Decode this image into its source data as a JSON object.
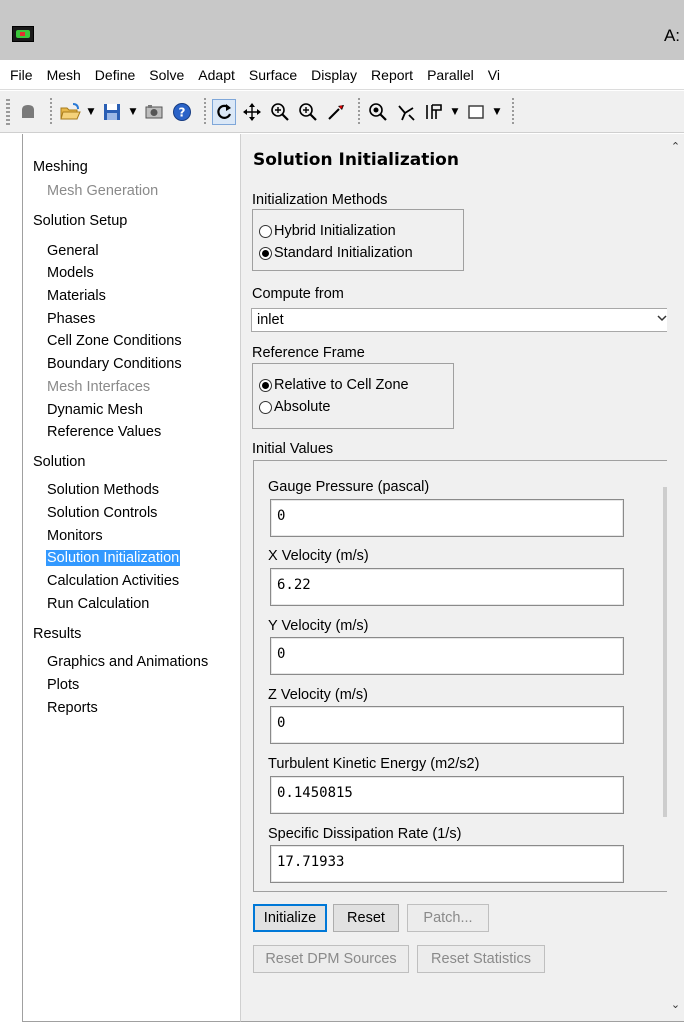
{
  "window": {
    "title_fragment": "A:"
  },
  "menu": [
    "File",
    "Mesh",
    "Define",
    "Solve",
    "Adapt",
    "Surface",
    "Display",
    "Report",
    "Parallel",
    "Vi"
  ],
  "toolbar": {
    "icons": [
      "stop-icon",
      "open-folder-icon",
      "save-icon",
      "camera-icon",
      "help-icon",
      "rotate-icon",
      "pan-icon",
      "zoom-icon",
      "zoom-fit-icon",
      "probe-icon",
      "zoom-region-icon",
      "axes-icon",
      "layout-icon",
      "view-box-icon"
    ]
  },
  "nav": {
    "sections": [
      {
        "label": "Meshing",
        "items": [
          {
            "label": "Mesh Generation",
            "disabled": true
          }
        ]
      },
      {
        "label": "Solution Setup",
        "items": [
          {
            "label": "General"
          },
          {
            "label": "Models"
          },
          {
            "label": "Materials"
          },
          {
            "label": "Phases"
          },
          {
            "label": "Cell Zone Conditions"
          },
          {
            "label": "Boundary Conditions"
          },
          {
            "label": "Mesh Interfaces",
            "disabled": true
          },
          {
            "label": "Dynamic Mesh"
          },
          {
            "label": "Reference Values"
          }
        ]
      },
      {
        "label": "Solution",
        "items": [
          {
            "label": "Solution Methods"
          },
          {
            "label": "Solution Controls"
          },
          {
            "label": "Monitors"
          },
          {
            "label": "Solution Initialization",
            "selected": true
          },
          {
            "label": "Calculation Activities"
          },
          {
            "label": "Run Calculation"
          }
        ]
      },
      {
        "label": "Results",
        "items": [
          {
            "label": "Graphics and Animations"
          },
          {
            "label": "Plots"
          },
          {
            "label": "Reports"
          }
        ]
      }
    ]
  },
  "task": {
    "title": "Solution Initialization",
    "methods": {
      "label": "Initialization Methods",
      "options": [
        {
          "label": "Hybrid  Initialization",
          "checked": false
        },
        {
          "label": "Standard Initialization",
          "checked": true
        }
      ]
    },
    "compute_from": {
      "label": "Compute from",
      "value": "inlet"
    },
    "reference_frame": {
      "label": "Reference Frame",
      "options": [
        {
          "label": "Relative to Cell Zone",
          "checked": true
        },
        {
          "label": "Absolute",
          "checked": false
        }
      ]
    },
    "initial_values": {
      "label": "Initial Values",
      "fields": [
        {
          "label": "Gauge Pressure (pascal)",
          "value": "0"
        },
        {
          "label": "X Velocity (m/s)",
          "value": "6.22"
        },
        {
          "label": "Y Velocity (m/s)",
          "value": "0"
        },
        {
          "label": "Z Velocity (m/s)",
          "value": "0"
        },
        {
          "label": "Turbulent Kinetic Energy (m2/s2)",
          "value": "0.1450815"
        },
        {
          "label": "Specific Dissipation Rate (1/s)",
          "value": "17.71933"
        }
      ]
    },
    "buttons": {
      "initialize": "Initialize",
      "reset": "Reset",
      "patch": "Patch...",
      "reset_dpm": "Reset DPM Sources",
      "reset_stats": "Reset Statistics"
    }
  }
}
